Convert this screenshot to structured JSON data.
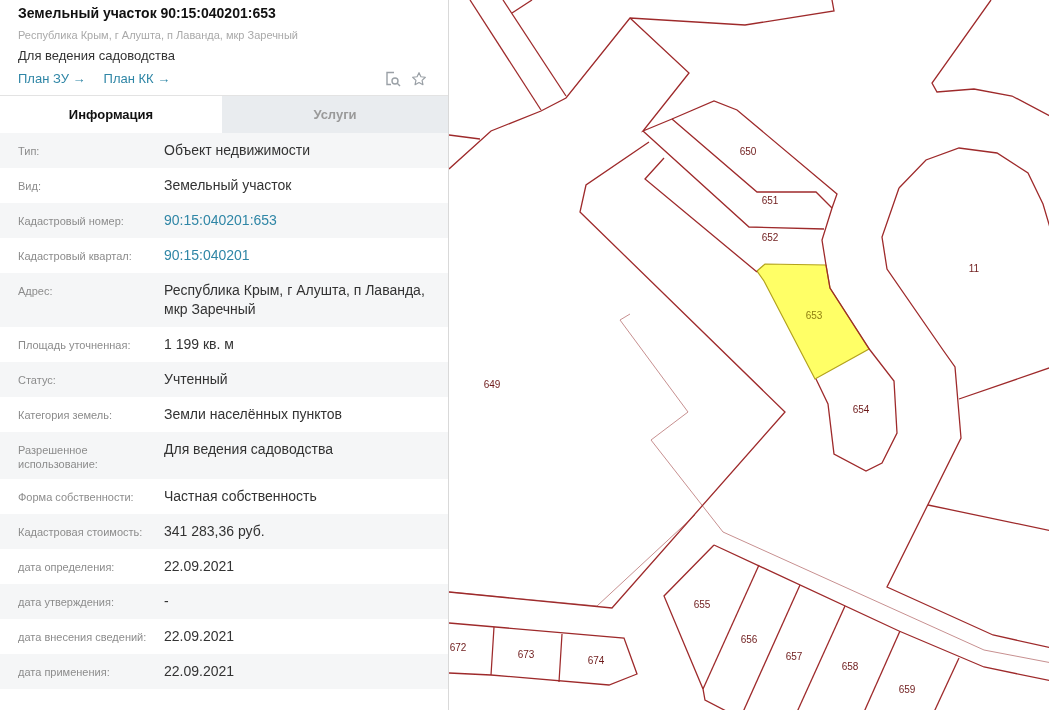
{
  "card": {
    "title": "Земельный участок 90:15:040201:653",
    "address": "Республика Крым, г Алушта, п Лаванда, мкр Заречный",
    "purpose": "Для ведения садоводства",
    "links": [
      {
        "label": "План ЗУ →"
      },
      {
        "label": "План КК →"
      }
    ]
  },
  "tabs": [
    {
      "label": "Информация",
      "selected": true
    },
    {
      "label": "Услуги",
      "selected": false
    }
  ],
  "properties": [
    {
      "label": "Тип:",
      "value": "Объект недвижимости",
      "kind": "text"
    },
    {
      "label": "Вид:",
      "value": "Земельный участок",
      "kind": "text"
    },
    {
      "label": "Кадастровый номер:",
      "value": "90:15:040201:653",
      "kind": "link"
    },
    {
      "label": "Кадастровый квартал:",
      "value": "90:15:040201",
      "kind": "link"
    },
    {
      "label": "Адрес:",
      "value": "Республика Крым, г Алушта, п Лаванда, мкр Заречный",
      "kind": "text"
    },
    {
      "label": "Площадь уточненная:",
      "value": "1 199 кв. м",
      "kind": "text"
    },
    {
      "label": "Статус:",
      "value": "Учтенный",
      "kind": "text"
    },
    {
      "label": "Категория земель:",
      "value": "Земли населённых пунктов",
      "kind": "text"
    },
    {
      "label": "Разрешенное использование:",
      "value": "Для ведения садоводства",
      "kind": "text"
    },
    {
      "label": "Форма собственности:",
      "value": "Частная собственность",
      "kind": "text"
    },
    {
      "label": "Кадастровая стоимость:",
      "value": "341 283,36 руб.",
      "kind": "text"
    },
    {
      "label": "дата определения:",
      "value": "22.09.2021",
      "kind": "text"
    },
    {
      "label": "дата утверждения:",
      "value": "-",
      "kind": "text"
    },
    {
      "label": "дата внесения сведений:",
      "value": "22.09.2021",
      "kind": "text"
    },
    {
      "label": "дата применения:",
      "value": "22.09.2021",
      "kind": "text"
    }
  ],
  "map": {
    "parcels": [
      {
        "label": "650",
        "selected": false
      },
      {
        "label": "651",
        "selected": false
      },
      {
        "label": "652",
        "selected": false
      },
      {
        "label": "653",
        "selected": true
      },
      {
        "label": "11",
        "selected": false
      },
      {
        "label": "649",
        "selected": false
      },
      {
        "label": "654",
        "selected": false
      },
      {
        "label": "655",
        "selected": false
      },
      {
        "label": "656",
        "selected": false
      },
      {
        "label": "657",
        "selected": false
      },
      {
        "label": "658",
        "selected": false
      },
      {
        "label": "659",
        "selected": false
      },
      {
        "label": "672",
        "selected": false
      },
      {
        "label": "673",
        "selected": false
      },
      {
        "label": "674",
        "selected": false
      }
    ]
  }
}
